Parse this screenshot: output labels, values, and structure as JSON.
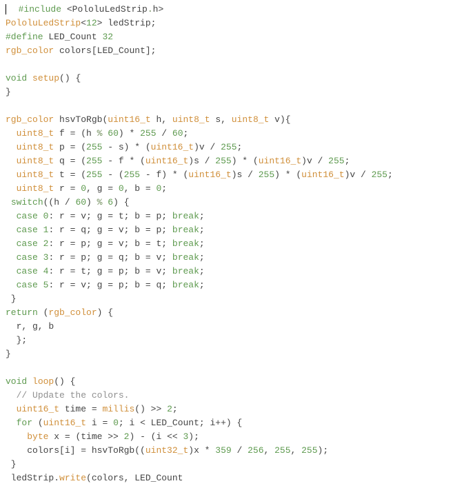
{
  "code": {
    "tokens": [
      [
        [
          "cursor",
          ""
        ],
        [
          "plain",
          "  "
        ],
        [
          "keyword",
          "#include"
        ],
        [
          "plain",
          " <"
        ],
        [
          "ident",
          "PololuLedStrip"
        ],
        [
          "op",
          "."
        ],
        [
          "ident",
          "h"
        ],
        [
          "plain",
          ">"
        ]
      ],
      [
        [
          "class",
          "PololuLedStrip"
        ],
        [
          "plain",
          "<"
        ],
        [
          "num",
          "12"
        ],
        [
          "plain",
          "> "
        ],
        [
          "ident",
          "ledStrip"
        ],
        [
          "punct",
          ";"
        ]
      ],
      [
        [
          "keyword",
          "#define"
        ],
        [
          "plain",
          " "
        ],
        [
          "ident",
          "LED_Count"
        ],
        [
          "plain",
          " "
        ],
        [
          "num",
          "32"
        ]
      ],
      [
        [
          "type",
          "rgb_color"
        ],
        [
          "plain",
          " "
        ],
        [
          "ident",
          "colors"
        ],
        [
          "plain",
          "["
        ],
        [
          "ident",
          "LED_Count"
        ],
        [
          "plain",
          "];"
        ]
      ],
      [
        [
          "plain",
          ""
        ]
      ],
      [
        [
          "keyword",
          "void"
        ],
        [
          "plain",
          " "
        ],
        [
          "func",
          "setup"
        ],
        [
          "plain",
          "() {"
        ]
      ],
      [
        [
          "plain",
          "}"
        ]
      ],
      [
        [
          "plain",
          ""
        ]
      ],
      [
        [
          "type",
          "rgb_color"
        ],
        [
          "plain",
          " "
        ],
        [
          "ident",
          "hsvToRgb"
        ],
        [
          "plain",
          "("
        ],
        [
          "type",
          "uint16_t"
        ],
        [
          "plain",
          " h, "
        ],
        [
          "type",
          "uint8_t"
        ],
        [
          "plain",
          " s, "
        ],
        [
          "type",
          "uint8_t"
        ],
        [
          "plain",
          " v){"
        ]
      ],
      [
        [
          "plain",
          "  "
        ],
        [
          "type",
          "uint8_t"
        ],
        [
          "plain",
          " f = (h "
        ],
        [
          "op",
          "%"
        ],
        [
          "plain",
          " "
        ],
        [
          "num",
          "60"
        ],
        [
          "plain",
          ") * "
        ],
        [
          "num",
          "255"
        ],
        [
          "plain",
          " / "
        ],
        [
          "num",
          "60"
        ],
        [
          "plain",
          ";"
        ]
      ],
      [
        [
          "plain",
          "  "
        ],
        [
          "type",
          "uint8_t"
        ],
        [
          "plain",
          " p = ("
        ],
        [
          "num",
          "255"
        ],
        [
          "plain",
          " - s) * ("
        ],
        [
          "type",
          "uint16_t"
        ],
        [
          "plain",
          ")v / "
        ],
        [
          "num",
          "255"
        ],
        [
          "plain",
          ";"
        ]
      ],
      [
        [
          "plain",
          "  "
        ],
        [
          "type",
          "uint8_t"
        ],
        [
          "plain",
          " q = ("
        ],
        [
          "num",
          "255"
        ],
        [
          "plain",
          " - f * ("
        ],
        [
          "type",
          "uint16_t"
        ],
        [
          "plain",
          ")s / "
        ],
        [
          "num",
          "255"
        ],
        [
          "plain",
          ") * ("
        ],
        [
          "type",
          "uint16_t"
        ],
        [
          "plain",
          ")v / "
        ],
        [
          "num",
          "255"
        ],
        [
          "plain",
          ";"
        ]
      ],
      [
        [
          "plain",
          "  "
        ],
        [
          "type",
          "uint8_t"
        ],
        [
          "plain",
          " t = ("
        ],
        [
          "num",
          "255"
        ],
        [
          "plain",
          " - ("
        ],
        [
          "num",
          "255"
        ],
        [
          "plain",
          " - f) * ("
        ],
        [
          "type",
          "uint16_t"
        ],
        [
          "plain",
          ")s / "
        ],
        [
          "num",
          "255"
        ],
        [
          "plain",
          ") * ("
        ],
        [
          "type",
          "uint16_t"
        ],
        [
          "plain",
          ")v / "
        ],
        [
          "num",
          "255"
        ],
        [
          "plain",
          ";"
        ]
      ],
      [
        [
          "plain",
          "  "
        ],
        [
          "type",
          "uint8_t"
        ],
        [
          "plain",
          " r = "
        ],
        [
          "num",
          "0"
        ],
        [
          "plain",
          ", g = "
        ],
        [
          "num",
          "0"
        ],
        [
          "plain",
          ", b = "
        ],
        [
          "num",
          "0"
        ],
        [
          "plain",
          ";"
        ]
      ],
      [
        [
          "plain",
          " "
        ],
        [
          "keyword",
          "switch"
        ],
        [
          "plain",
          "((h / "
        ],
        [
          "num",
          "60"
        ],
        [
          "plain",
          ") "
        ],
        [
          "op",
          "%"
        ],
        [
          "plain",
          " "
        ],
        [
          "num",
          "6"
        ],
        [
          "plain",
          ") {"
        ]
      ],
      [
        [
          "plain",
          "  "
        ],
        [
          "keyword",
          "case"
        ],
        [
          "plain",
          " "
        ],
        [
          "num",
          "0"
        ],
        [
          "plain",
          ": r = v; g = t; b = p; "
        ],
        [
          "keyword",
          "break"
        ],
        [
          "plain",
          ";"
        ]
      ],
      [
        [
          "plain",
          "  "
        ],
        [
          "keyword",
          "case"
        ],
        [
          "plain",
          " "
        ],
        [
          "num",
          "1"
        ],
        [
          "plain",
          ": r = q; g = v; b = p; "
        ],
        [
          "keyword",
          "break"
        ],
        [
          "plain",
          ";"
        ]
      ],
      [
        [
          "plain",
          "  "
        ],
        [
          "keyword",
          "case"
        ],
        [
          "plain",
          " "
        ],
        [
          "num",
          "2"
        ],
        [
          "plain",
          ": r = p; g = v; b = t; "
        ],
        [
          "keyword",
          "break"
        ],
        [
          "plain",
          ";"
        ]
      ],
      [
        [
          "plain",
          "  "
        ],
        [
          "keyword",
          "case"
        ],
        [
          "plain",
          " "
        ],
        [
          "num",
          "3"
        ],
        [
          "plain",
          ": r = p; g = q; b = v; "
        ],
        [
          "keyword",
          "break"
        ],
        [
          "plain",
          ";"
        ]
      ],
      [
        [
          "plain",
          "  "
        ],
        [
          "keyword",
          "case"
        ],
        [
          "plain",
          " "
        ],
        [
          "num",
          "4"
        ],
        [
          "plain",
          ": r = t; g = p; b = v; "
        ],
        [
          "keyword",
          "break"
        ],
        [
          "plain",
          ";"
        ]
      ],
      [
        [
          "plain",
          "  "
        ],
        [
          "keyword",
          "case"
        ],
        [
          "plain",
          " "
        ],
        [
          "num",
          "5"
        ],
        [
          "plain",
          ": r = v; g = p; b = q; "
        ],
        [
          "keyword",
          "break"
        ],
        [
          "plain",
          ";"
        ]
      ],
      [
        [
          "plain",
          " }"
        ]
      ],
      [
        [
          "keyword",
          "return"
        ],
        [
          "plain",
          " ("
        ],
        [
          "type",
          "rgb_color"
        ],
        [
          "plain",
          ") {"
        ]
      ],
      [
        [
          "plain",
          "  r, g, b"
        ]
      ],
      [
        [
          "plain",
          "  };"
        ]
      ],
      [
        [
          "plain",
          "}"
        ]
      ],
      [
        [
          "plain",
          ""
        ]
      ],
      [
        [
          "keyword",
          "void"
        ],
        [
          "plain",
          " "
        ],
        [
          "func",
          "loop"
        ],
        [
          "plain",
          "() {"
        ]
      ],
      [
        [
          "plain",
          "  "
        ],
        [
          "comment",
          "// Update the colors."
        ]
      ],
      [
        [
          "plain",
          "  "
        ],
        [
          "type",
          "uint16_t"
        ],
        [
          "plain",
          " time = "
        ],
        [
          "func",
          "millis"
        ],
        [
          "plain",
          "() >> "
        ],
        [
          "num",
          "2"
        ],
        [
          "plain",
          ";"
        ]
      ],
      [
        [
          "plain",
          "  "
        ],
        [
          "keyword",
          "for"
        ],
        [
          "plain",
          " ("
        ],
        [
          "type",
          "uint16_t"
        ],
        [
          "plain",
          " i = "
        ],
        [
          "num",
          "0"
        ],
        [
          "plain",
          "; i < LED_Count; i++) {"
        ]
      ],
      [
        [
          "plain",
          "    "
        ],
        [
          "type",
          "byte"
        ],
        [
          "plain",
          " x = (time >> "
        ],
        [
          "num",
          "2"
        ],
        [
          "plain",
          ") - (i << "
        ],
        [
          "num",
          "3"
        ],
        [
          "plain",
          ");"
        ]
      ],
      [
        [
          "plain",
          "    colors[i] = hsvToRgb(("
        ],
        [
          "type",
          "uint32_t"
        ],
        [
          "plain",
          ")x * "
        ],
        [
          "num",
          "359"
        ],
        [
          "plain",
          " / "
        ],
        [
          "num",
          "256"
        ],
        [
          "plain",
          ", "
        ],
        [
          "num",
          "255"
        ],
        [
          "plain",
          ", "
        ],
        [
          "num",
          "255"
        ],
        [
          "plain",
          ");"
        ]
      ],
      [
        [
          "plain",
          " }"
        ]
      ],
      [
        [
          "plain",
          " ledStrip."
        ],
        [
          "func",
          "write"
        ],
        [
          "plain",
          "(colors, LED_Count"
        ]
      ]
    ]
  }
}
